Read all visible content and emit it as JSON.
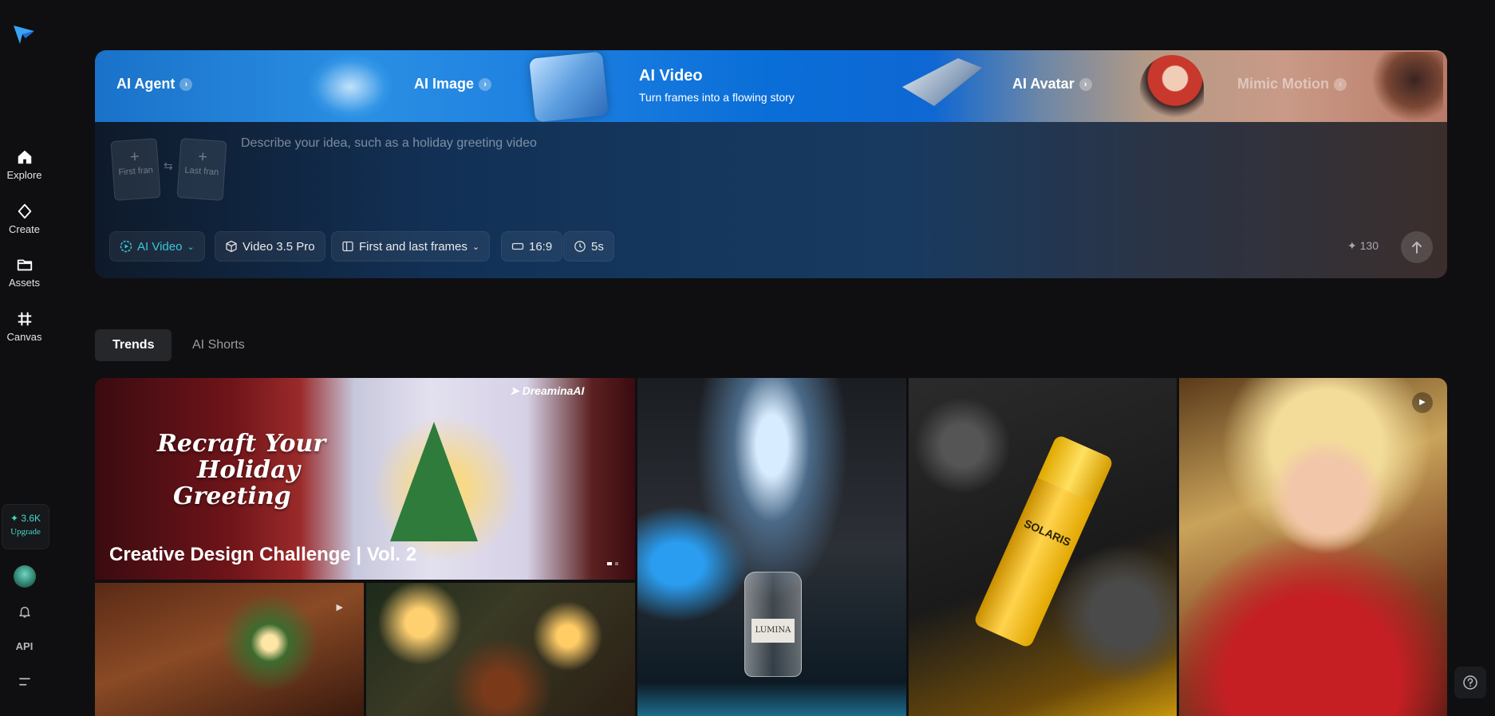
{
  "sidebar": {
    "logo_icon": "dreamina-logo-icon",
    "items": [
      {
        "label": "Explore",
        "icon": "home-icon"
      },
      {
        "label": "Create",
        "icon": "sparkle-diamond-icon"
      },
      {
        "label": "Assets",
        "icon": "folder-icon"
      },
      {
        "label": "Canvas",
        "icon": "canvas-grid-icon"
      }
    ],
    "credits": "✦ 3.6K",
    "upgrade_label": "Upgrade",
    "api_label": "API"
  },
  "banner": {
    "tabs": [
      {
        "label": "AI Agent"
      },
      {
        "label": "AI Image"
      },
      {
        "label": "AI Video",
        "subtitle": "Turn frames into a flowing story"
      },
      {
        "label": "AI Avatar"
      },
      {
        "label": "Mimic Motion"
      }
    ]
  },
  "prompt": {
    "first_frame": "First fran",
    "last_frame": "Last fran",
    "placeholder": "Describe your idea, such as a holiday greeting video",
    "tools": {
      "mode": "AI Video",
      "model": "Video 3.5 Pro",
      "frames": "First and last frames",
      "ratio": "16:9",
      "duration": "5s"
    },
    "cost": "130"
  },
  "feed": {
    "tabs": [
      "Trends",
      "AI Shorts"
    ],
    "feature": {
      "headline_line1": "Recraft Your",
      "headline_line2": "Holiday",
      "headline_line3": "Greeting",
      "brand": "DreaminaAI",
      "title": "Creative Design Challenge | Vol. 2"
    },
    "products": [
      "LUMINA",
      "SOLARIS"
    ]
  },
  "colors": {
    "accent": "#38c8d8",
    "background": "#0f0f11"
  }
}
